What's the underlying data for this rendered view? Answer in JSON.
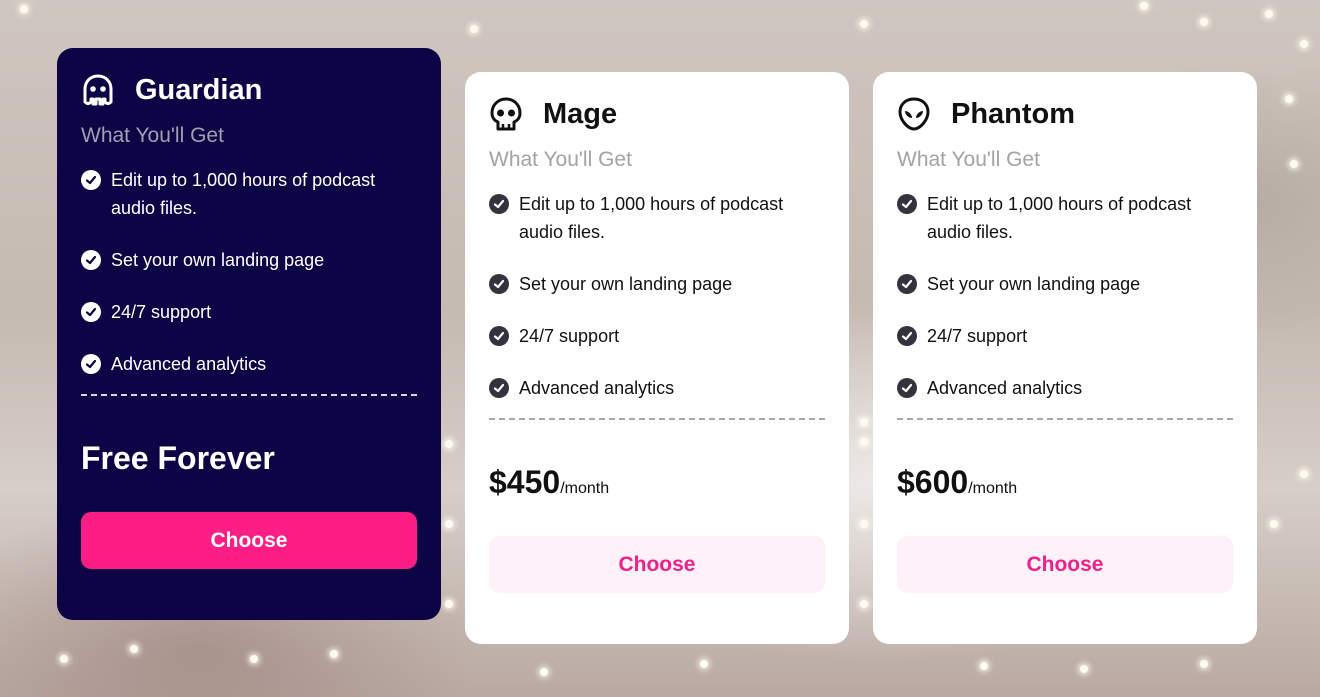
{
  "plans": [
    {
      "name": "Guardian",
      "icon": "ghost-icon",
      "subtitle": "What You'll Get",
      "features": [
        "Edit up to 1,000 hours of podcast audio files.",
        "Set your own landing page",
        "24/7 support",
        "Advanced analytics"
      ],
      "price_text": "Free Forever",
      "button_label": "Choose"
    },
    {
      "name": "Mage",
      "icon": "skull-icon",
      "subtitle": "What You'll Get",
      "features": [
        "Edit up to 1,000 hours of podcast audio files.",
        "Set your own landing page",
        "24/7 support",
        "Advanced analytics"
      ],
      "price_amount": "$450",
      "price_period": "/month",
      "button_label": "Choose"
    },
    {
      "name": "Phantom",
      "icon": "alien-icon",
      "subtitle": "What You'll Get",
      "features": [
        "Edit up to 1,000 hours of podcast audio files.",
        "Set your own landing page",
        "24/7 support",
        "Advanced analytics"
      ],
      "price_amount": "$600",
      "price_period": "/month",
      "button_label": "Choose"
    }
  ],
  "colors": {
    "featured_card_bg": "#0c0444",
    "accent_pink": "#fc1e85",
    "light_button_bg": "#fff1f8"
  }
}
